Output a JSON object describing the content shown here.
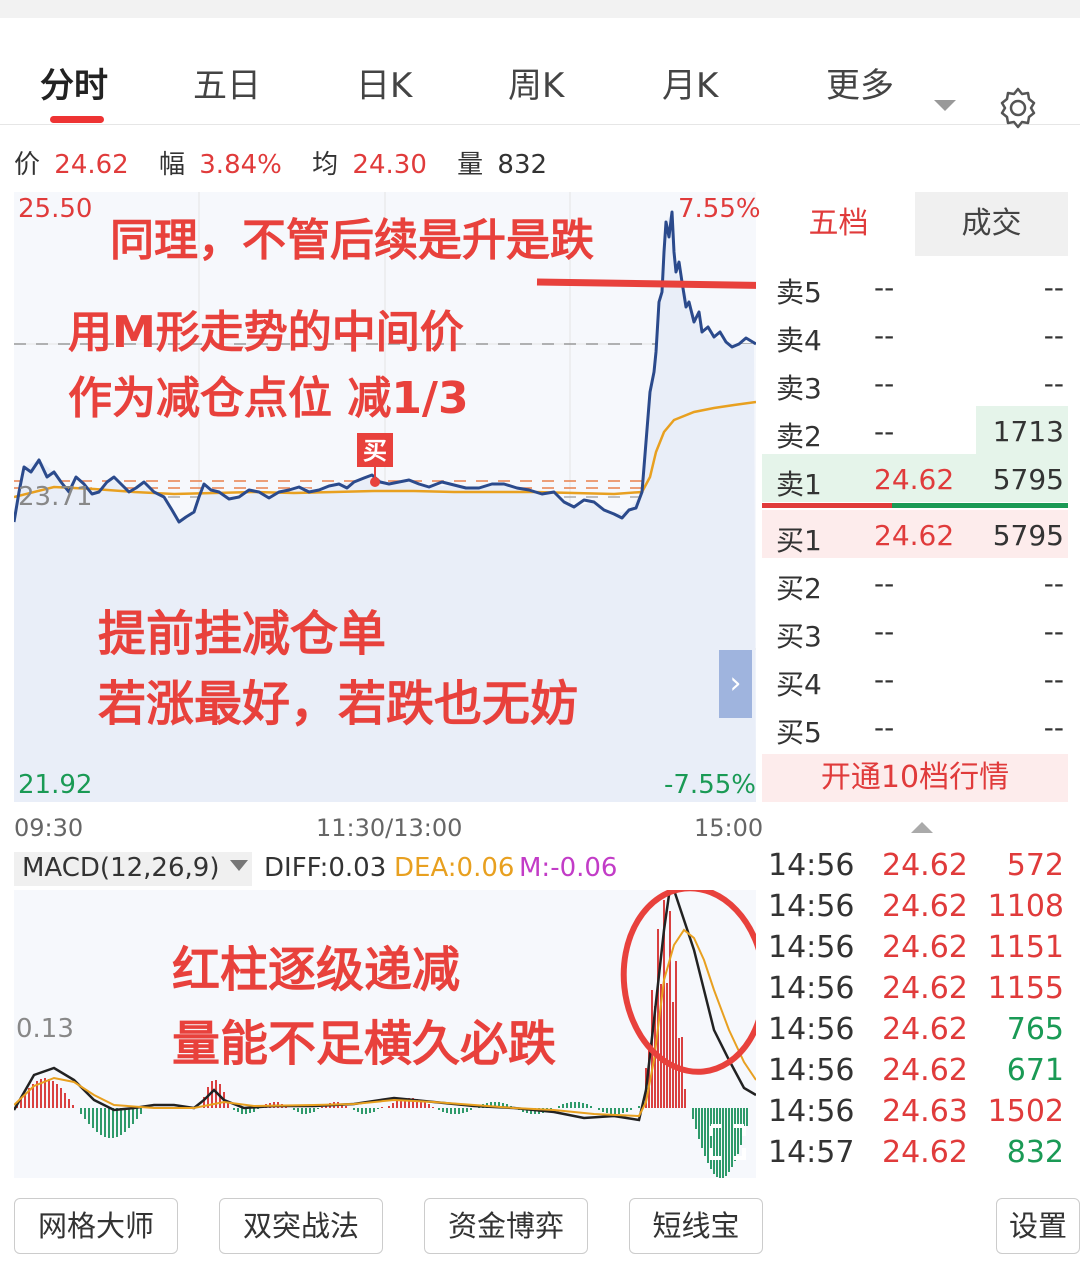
{
  "tabs": [
    {
      "label": "分时"
    },
    {
      "label": "五日"
    },
    {
      "label": "日K"
    },
    {
      "label": "周K"
    },
    {
      "label": "月K"
    },
    {
      "label": "更多"
    }
  ],
  "info": {
    "price_label": "价",
    "price": "24.62",
    "change_label": "幅",
    "change": "3.84%",
    "avg_label": "均",
    "avg": "24.30",
    "vol_label": "量",
    "vol": "832"
  },
  "chart": {
    "y_high": "25.50",
    "y_low": "21.92",
    "pct_high": "7.55%",
    "pct_low": "-7.55%",
    "prev_close_label": "23.71",
    "buy_marker": "买",
    "time_start": "09:30",
    "time_mid": "11:30/13:00",
    "time_end": "15:00"
  },
  "macd": {
    "selector": "MACD(12,26,9)",
    "diff": "DIFF:0.03",
    "dea": "DEA:0.06",
    "m": "M:-0.06",
    "y_label": "0.13"
  },
  "annotations": {
    "a1": "同理，不管后续是升是跌",
    "a2": "用M形走势的中间价",
    "a3": "作为减仓点位 减1/3",
    "a4": "提前挂减仓单",
    "a5": "若涨最好，若跌也无妨",
    "a6": "红柱逐级递减",
    "a7": "量能不足横久必跌"
  },
  "orderbook": {
    "tab_five": "五档",
    "tab_deal": "成交",
    "asks": [
      {
        "label": "卖5",
        "price": "--",
        "vol": "--"
      },
      {
        "label": "卖4",
        "price": "--",
        "vol": "--"
      },
      {
        "label": "卖3",
        "price": "--",
        "vol": "--"
      },
      {
        "label": "卖2",
        "price": "--",
        "vol": "1713"
      },
      {
        "label": "卖1",
        "price": "24.62",
        "vol": "5795"
      }
    ],
    "bids": [
      {
        "label": "买1",
        "price": "24.62",
        "vol": "5795"
      },
      {
        "label": "买2",
        "price": "--",
        "vol": "--"
      },
      {
        "label": "买3",
        "price": "--",
        "vol": "--"
      },
      {
        "label": "买4",
        "price": "--",
        "vol": "--"
      },
      {
        "label": "买5",
        "price": "--",
        "vol": "--"
      }
    ],
    "more": "开通10档行情"
  },
  "ticks": [
    {
      "time": "14:56",
      "price": "24.62",
      "vol": "572",
      "dir": "up"
    },
    {
      "time": "14:56",
      "price": "24.62",
      "vol": "1108",
      "dir": "up"
    },
    {
      "time": "14:56",
      "price": "24.62",
      "vol": "1151",
      "dir": "up"
    },
    {
      "time": "14:56",
      "price": "24.62",
      "vol": "1155",
      "dir": "up"
    },
    {
      "time": "14:56",
      "price": "24.62",
      "vol": "765",
      "dir": "down"
    },
    {
      "time": "14:56",
      "price": "24.62",
      "vol": "671",
      "dir": "down"
    },
    {
      "time": "14:56",
      "price": "24.63",
      "vol": "1502",
      "dir": "up"
    },
    {
      "time": "14:57",
      "price": "24.62",
      "vol": "832",
      "dir": "down"
    }
  ],
  "bottom_buttons": [
    "网格大师",
    "双突战法",
    "资金博弈",
    "短线宝",
    "设置"
  ],
  "colors": {
    "up": "#e03b3b",
    "down": "#1a9a55",
    "price_line": "#2b4a8c",
    "avg_line": "#e8a020",
    "accent": "#e33"
  }
}
